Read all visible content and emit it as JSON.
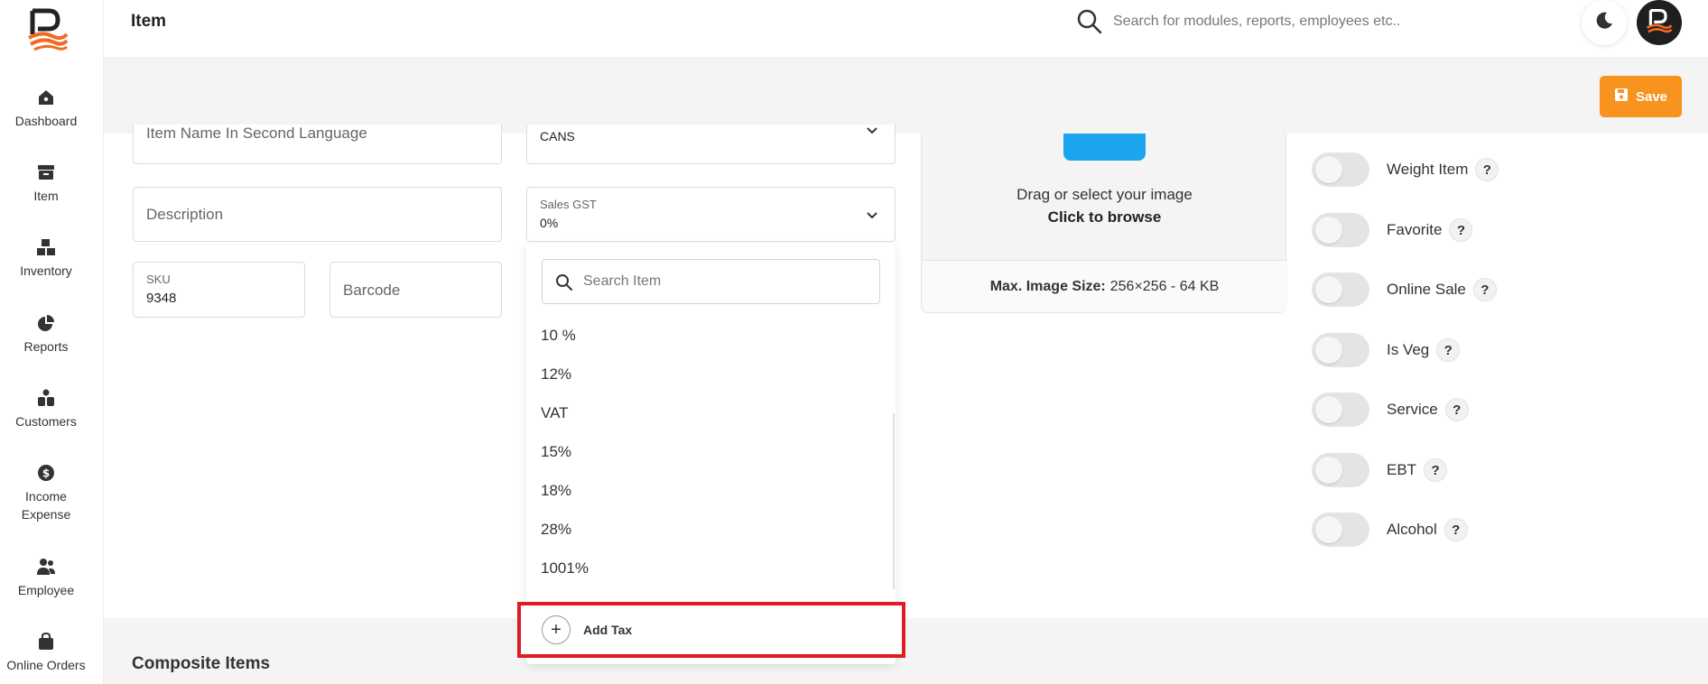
{
  "app": {
    "logo_icon": "brand-logo-icon",
    "accent_color": "#f7931e"
  },
  "sidebar": {
    "items": [
      {
        "label": "Dashboard",
        "icon": "home-icon"
      },
      {
        "label": "Item",
        "icon": "archive-box-icon"
      },
      {
        "label": "Inventory",
        "icon": "boxes-icon"
      },
      {
        "label": "Reports",
        "icon": "pie-chart-icon"
      },
      {
        "label": "Customers",
        "icon": "people-icon"
      },
      {
        "label": "Income Expense",
        "icon": "dollar-coin-icon"
      },
      {
        "label": "Employee",
        "icon": "user-group-icon"
      },
      {
        "label": "Online Orders",
        "icon": "shopping-bag-icon"
      }
    ]
  },
  "header": {
    "title": "Item",
    "search_placeholder": "Search for modules, reports, employees etc.."
  },
  "toolbar": {
    "save_label": "Save"
  },
  "form": {
    "second_language_placeholder": "Item Name In Second Language",
    "unit_value": "CANS",
    "description_placeholder": "Description",
    "sales_gst_label": "Sales GST",
    "sales_gst_value": "0%",
    "sku_label": "SKU",
    "sku_value": "9348",
    "barcode_placeholder": "Barcode"
  },
  "image_upload": {
    "drag_text": "Drag or select your image",
    "browse_text": "Click to browse",
    "max_size_label": "Max. Image Size:",
    "max_size_value": "256×256 - 64 KB"
  },
  "toggles": [
    {
      "label": "Weight Item",
      "on": false
    },
    {
      "label": "Favorite",
      "on": false
    },
    {
      "label": "Online Sale",
      "on": false
    },
    {
      "label": "Is Veg",
      "on": false
    },
    {
      "label": "Service",
      "on": false
    },
    {
      "label": "EBT",
      "on": false
    },
    {
      "label": "Alcohol",
      "on": false
    }
  ],
  "help_glyph": "?",
  "tax_dropdown": {
    "search_placeholder": "Search Item",
    "options": [
      "10 %",
      "12%",
      "VAT",
      "15%",
      "18%",
      "28%",
      "1001%"
    ],
    "add_tax_label": "Add Tax",
    "add_icon": "+",
    "highlight_color": "#e01b24"
  },
  "sections": {
    "composite_title": "Composite Items"
  }
}
